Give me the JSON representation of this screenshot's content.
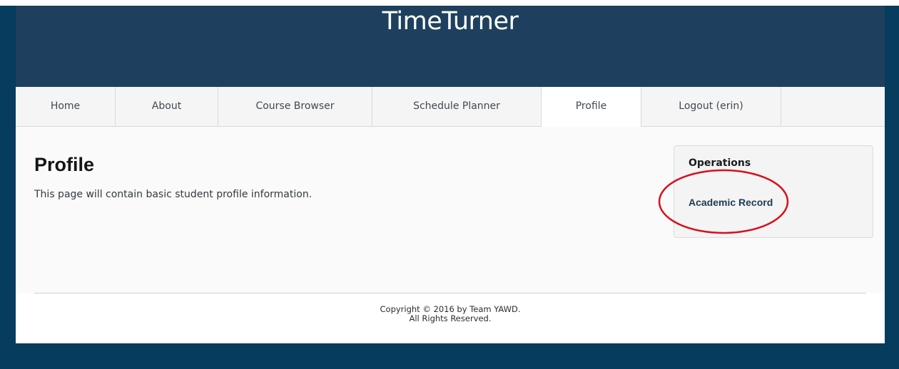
{
  "header": {
    "title": "TimeTurner"
  },
  "nav": {
    "tabs": [
      {
        "label": "Home"
      },
      {
        "label": "About"
      },
      {
        "label": "Course Browser"
      },
      {
        "label": "Schedule Planner"
      },
      {
        "label": "Profile",
        "active": true
      },
      {
        "label": "Logout (erin)"
      }
    ]
  },
  "main": {
    "title": "Profile",
    "description": "This page will contain basic student profile information."
  },
  "sidebar": {
    "heading": "Operations",
    "link": "Academic Record",
    "highlight_color": "#d8101c"
  },
  "footer": {
    "line1": "Copyright © 2016 by Team YAWD.",
    "line2": "All Rights Reserved."
  },
  "colors": {
    "header_bg": "#1e405e",
    "page_bg": "#063c5e"
  }
}
